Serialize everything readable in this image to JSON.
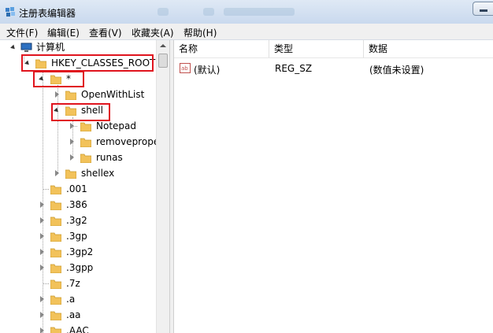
{
  "window": {
    "title": "注册表编辑器"
  },
  "menu": [
    {
      "label": "文件(F)"
    },
    {
      "label": "编辑(E)"
    },
    {
      "label": "查看(V)"
    },
    {
      "label": "收藏夹(A)"
    },
    {
      "label": "帮助(H)"
    }
  ],
  "tree": {
    "root": "计算机",
    "hkcr": "HKEY_CLASSES_ROOT",
    "star": "*",
    "star_children": [
      "OpenWithList",
      "shell",
      "shellex"
    ],
    "shell_children": [
      "Notepad",
      "removeprope",
      "runas"
    ],
    "extensions": [
      ".001",
      ".386",
      ".3g2",
      ".3gp",
      ".3gp2",
      ".3gpp",
      ".7z",
      ".a",
      ".aa",
      ".AAC"
    ]
  },
  "list": {
    "columns": [
      "名称",
      "类型",
      "数据"
    ],
    "rows": [
      {
        "name": "(默认)",
        "type": "REG_SZ",
        "data": "(数值未设置)",
        "icon": "string-value-icon"
      }
    ]
  },
  "colors": {
    "highlight_box": "#e0141e",
    "folder": "#f2c25a"
  }
}
